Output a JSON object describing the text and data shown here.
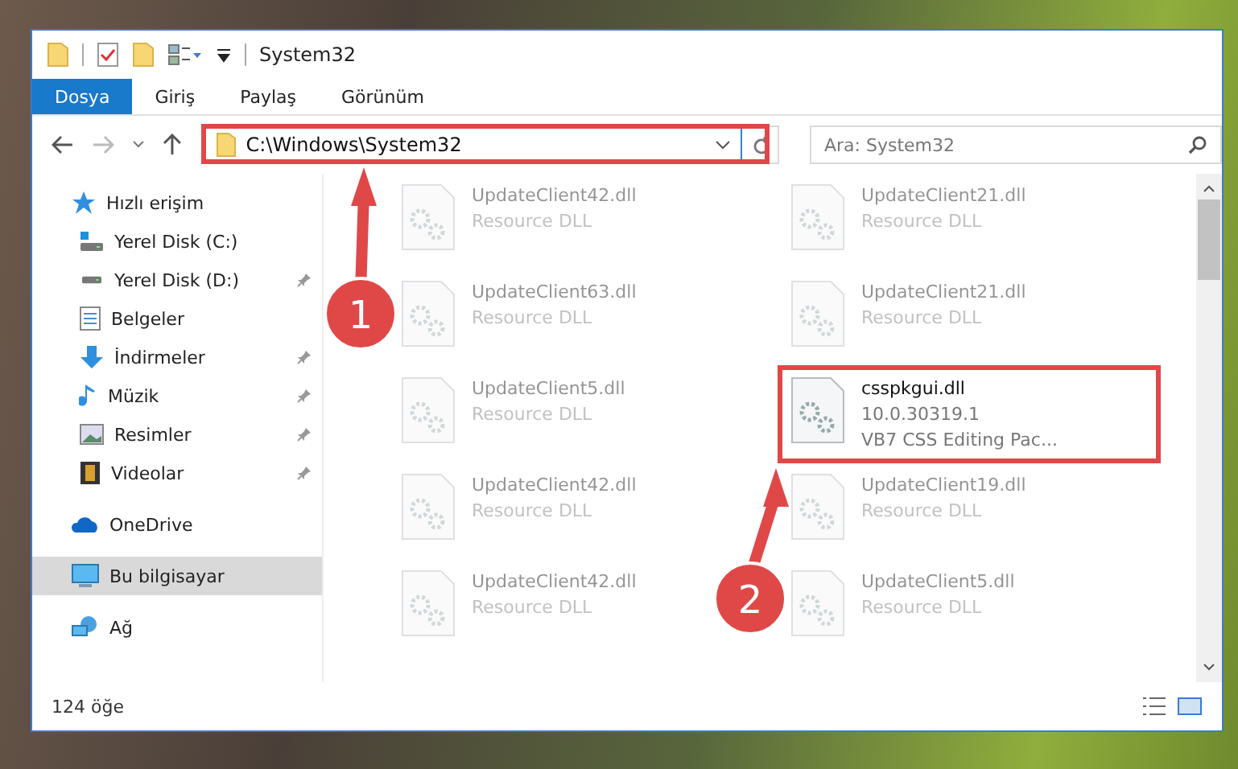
{
  "window": {
    "title": "System32"
  },
  "ribbon_tabs": [
    {
      "label": "Dosya",
      "selected": true
    },
    {
      "label": "Giriş",
      "selected": false
    },
    {
      "label": "Paylaş",
      "selected": false
    },
    {
      "label": "Görünüm",
      "selected": false
    }
  ],
  "address_bar": {
    "path": "C:\\Windows\\System32"
  },
  "search": {
    "placeholder": "Ara: System32"
  },
  "sidebar": {
    "items": [
      {
        "label": "Hızlı erişim",
        "selected": false,
        "children": [
          {
            "label": "Yerel Disk (C:)",
            "selected": false,
            "pinned": false
          },
          {
            "label": "Yerel Disk (D:)",
            "selected": false,
            "pinned": true
          },
          {
            "label": "Belgeler",
            "selected": false,
            "pinned": false
          },
          {
            "label": "İndirmeler",
            "selected": false,
            "pinned": true
          },
          {
            "label": "Müzik",
            "selected": false,
            "pinned": true
          },
          {
            "label": "Resimler",
            "selected": false,
            "pinned": true
          },
          {
            "label": "Videolar",
            "selected": false,
            "pinned": true
          }
        ]
      },
      {
        "label": "OneDrive",
        "selected": false
      },
      {
        "label": "Bu bilgisayar",
        "selected": true
      },
      {
        "label": "Ağ",
        "selected": false
      }
    ]
  },
  "files": [
    {
      "name": "UpdateClient42.dll",
      "lines": [
        "Resource DLL"
      ],
      "kind": "blurred"
    },
    {
      "name": "UpdateClient21.dll",
      "lines": [
        "Resource DLL"
      ],
      "kind": "blurred"
    },
    {
      "name": "UpdateClient63.dll",
      "lines": [
        "Resource DLL"
      ],
      "kind": "blurred"
    },
    {
      "name": "UpdateClient21.dll",
      "lines": [
        "Resource DLL"
      ],
      "kind": "blurred"
    },
    {
      "name": "UpdateClient5.dll",
      "lines": [
        "Resource DLL"
      ],
      "kind": "blurred"
    },
    {
      "name": "csspkgui.dll",
      "lines": [
        "10.0.30319.1",
        "VB7 CSS Editing Pac..."
      ],
      "kind": "clear"
    },
    {
      "name": "UpdateClient42.dll",
      "lines": [
        "Resource DLL"
      ],
      "kind": "blurred"
    },
    {
      "name": "UpdateClient19.dll",
      "lines": [
        "Resource DLL"
      ],
      "kind": "blurred"
    },
    {
      "name": "UpdateClient42.dll",
      "lines": [
        "Resource DLL"
      ],
      "kind": "blurred"
    },
    {
      "name": "UpdateClient5.dll",
      "lines": [
        "Resource DLL"
      ],
      "kind": "blurred"
    }
  ],
  "status_bar": {
    "item_count": "124 öğe"
  },
  "callouts": [
    {
      "number": "1"
    },
    {
      "number": "2"
    }
  ]
}
